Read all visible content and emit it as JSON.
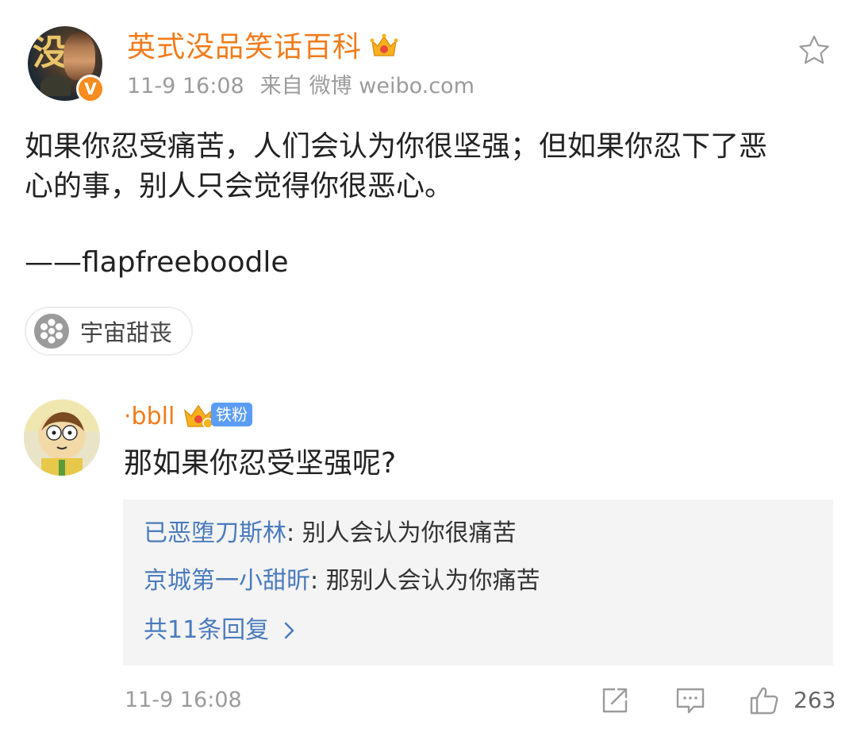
{
  "post": {
    "author": "英式没品笑话百科",
    "time": "11-9 16:08",
    "source_prefix": "来自",
    "source": "微博 weibo.com",
    "avatar_glyph": "没",
    "verified_glyph": "V",
    "text_line_1": "如果你忍受痛苦，人们会认为你很坚强；但如果你忍下了恶",
    "text_line_2": "心的事，别人只会觉得你很恶心。",
    "text_signature": "——flapfreeboodle",
    "topic": "宇宙甜丧"
  },
  "comment": {
    "author": "·bbll",
    "fan_badge": "铁粉",
    "text": "那如果你忍受坚强呢?",
    "replies": [
      {
        "who": "已恶堕刀斯林",
        "text": ": 别人会认为你很痛苦"
      },
      {
        "who": "京城第一小甜昕",
        "text": ": 那别人会认为你痛苦"
      }
    ],
    "more_replies": "共11条回复",
    "time": "11-9 16:08",
    "likes": "263"
  },
  "colors": {
    "author_orange": "#f27b1a",
    "link_blue": "#4a7bbd",
    "meta_gray": "#9b9b9b",
    "reply_bg": "#f4f4f4",
    "fan_badge_blue": "#5b9df5"
  },
  "icons": {
    "favorite": "star-outline-icon",
    "share": "share-icon",
    "comment": "comment-icon",
    "like": "thumbs-up-icon"
  }
}
